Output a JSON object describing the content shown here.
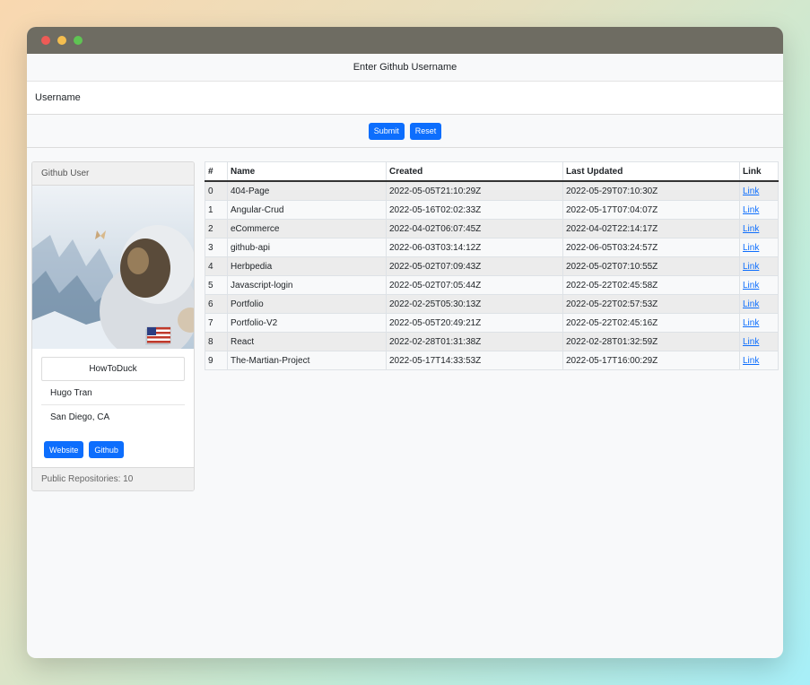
{
  "header": {
    "title": "Enter Github Username"
  },
  "search": {
    "placeholder": "Username",
    "value": ""
  },
  "actions": {
    "submit_label": "Submit",
    "reset_label": "Reset"
  },
  "user_card": {
    "header": "Github User",
    "login": "HowToDuck",
    "name": "Hugo Tran",
    "location": "San Diego, CA",
    "website_label": "Website",
    "github_label": "Github",
    "footer": "Public Repositories: 10"
  },
  "table": {
    "headers": {
      "index": "#",
      "name": "Name",
      "created": "Created",
      "updated": "Last Updated",
      "link": "Link"
    },
    "rows": [
      {
        "index": "0",
        "name": "404-Page",
        "created": "2022-05-05T21:10:29Z",
        "updated": "2022-05-29T07:10:30Z",
        "link": "Link"
      },
      {
        "index": "1",
        "name": "Angular-Crud",
        "created": "2022-05-16T02:02:33Z",
        "updated": "2022-05-17T07:04:07Z",
        "link": "Link"
      },
      {
        "index": "2",
        "name": "eCommerce",
        "created": "2022-04-02T06:07:45Z",
        "updated": "2022-04-02T22:14:17Z",
        "link": "Link"
      },
      {
        "index": "3",
        "name": "github-api",
        "created": "2022-06-03T03:14:12Z",
        "updated": "2022-06-05T03:24:57Z",
        "link": "Link"
      },
      {
        "index": "4",
        "name": "Herbpedia",
        "created": "2022-05-02T07:09:43Z",
        "updated": "2022-05-02T07:10:55Z",
        "link": "Link"
      },
      {
        "index": "5",
        "name": "Javascript-login",
        "created": "2022-05-02T07:05:44Z",
        "updated": "2022-05-22T02:45:58Z",
        "link": "Link"
      },
      {
        "index": "6",
        "name": "Portfolio",
        "created": "2022-02-25T05:30:13Z",
        "updated": "2022-05-22T02:57:53Z",
        "link": "Link"
      },
      {
        "index": "7",
        "name": "Portfolio-V2",
        "created": "2022-05-05T20:49:21Z",
        "updated": "2022-05-22T02:45:16Z",
        "link": "Link"
      },
      {
        "index": "8",
        "name": "React",
        "created": "2022-02-28T01:31:38Z",
        "updated": "2022-02-28T01:32:59Z",
        "link": "Link"
      },
      {
        "index": "9",
        "name": "The-Martian-Project",
        "created": "2022-05-17T14:33:53Z",
        "updated": "2022-05-17T16:00:29Z",
        "link": "Link"
      }
    ]
  },
  "colors": {
    "primary": "#0d6efd",
    "titlebar": "#6e6c62"
  }
}
